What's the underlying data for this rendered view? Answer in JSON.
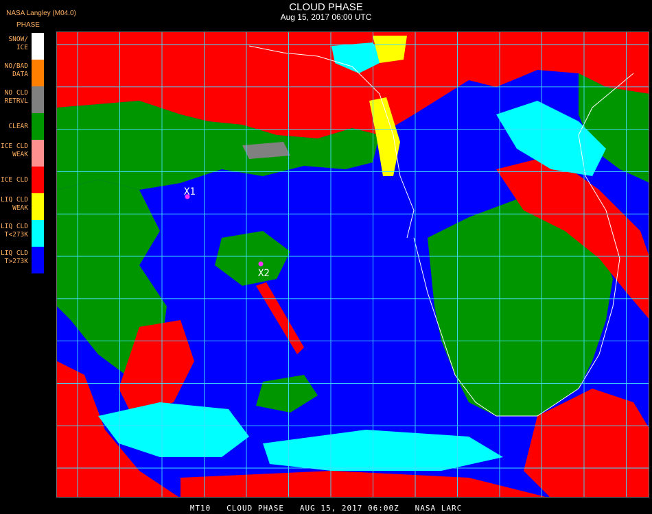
{
  "header": {
    "source": "NASA Langley (M04.0)",
    "phase_label": "PHASE",
    "title": "CLOUD PHASE",
    "subtitle": "Aug 15, 2017 06:00 UTC"
  },
  "legend": {
    "items": [
      {
        "label": "SNOW/\nICE",
        "color": "#ffffff"
      },
      {
        "label": "NO/BAD\nDATA",
        "color": "#ff8000"
      },
      {
        "label": "NO CLD\nRETRVL",
        "color": "#808080"
      },
      {
        "label": "CLEAR",
        "color": "#009600"
      },
      {
        "label": "ICE CLD\nWEAK",
        "color": "#ff9090"
      },
      {
        "label": "ICE CLD",
        "color": "#ff0000"
      },
      {
        "label": "LIQ CLD\nWEAK",
        "color": "#ffff00"
      },
      {
        "label": "LIQ CLD\nT<273K",
        "color": "#00ffff"
      },
      {
        "label": "LIQ CLD\nT>273K",
        "color": "#0000ff"
      }
    ]
  },
  "markers": [
    {
      "label": "X1",
      "color": "#ff33ff"
    },
    {
      "label": "X2",
      "color": "#ff33ff"
    }
  ],
  "map": {
    "grid_color": "#40e0ff",
    "coast_color": "#ffffff",
    "ocean_color": "#0000ff",
    "land_color": "#009600",
    "ice_cloud_color": "#ff0000",
    "liq_cold_color": "#00ffff",
    "liq_weak_color": "#ffff00",
    "no_retrieval_color": "#808080"
  },
  "footer": {
    "text": "MT10   CLOUD PHASE   AUG 15, 2017 06:00Z   NASA LARC"
  }
}
